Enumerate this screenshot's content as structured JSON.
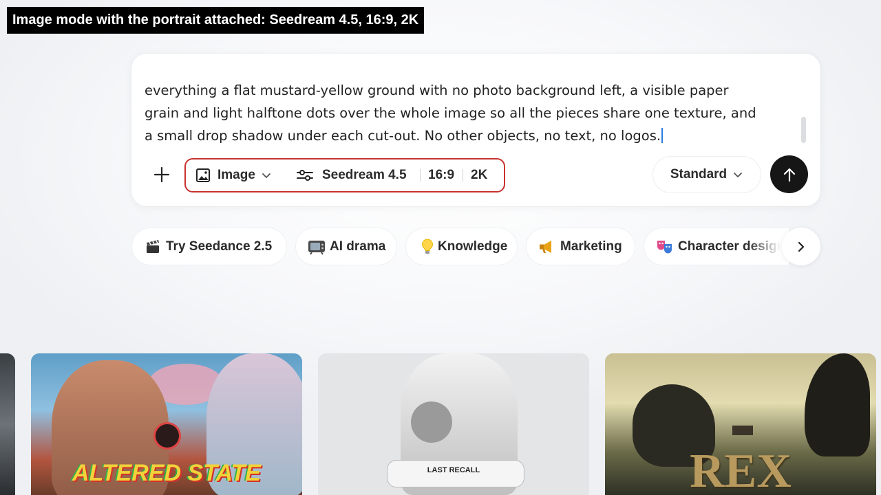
{
  "caption": "Image mode with the portrait attached: Seedream 4.5, 16:9, 2K",
  "composer": {
    "prompt_lines": [
      "everything a flat mustard-yellow ground with no photo background left, a visible paper",
      "grain and light halftone dots over the whole image so all the pieces share one texture, and",
      "a small drop shadow under each cut-out. No other objects, no text, no logos."
    ],
    "mode_label": "Image",
    "model_label": "Seedream 4.5",
    "ratio_label": "16:9",
    "resolution_label": "2K",
    "quality_label": "Standard"
  },
  "chips": [
    {
      "label": "Try Seedance 2.5",
      "icon": "clapperboard-icon"
    },
    {
      "label": "AI drama",
      "icon": "television-icon"
    },
    {
      "label": "Knowledge",
      "icon": "lightbulb-icon"
    },
    {
      "label": "Marketing",
      "icon": "megaphone-icon"
    },
    {
      "label": "Character design",
      "icon": "theater-masks-icon"
    }
  ],
  "gallery": {
    "card1_title": "ALTERED STATE",
    "card2_label": "LAST RECALL",
    "card3_title": "REX"
  },
  "colors": {
    "highlight_border": "#c8322e",
    "send_button": "#161616",
    "caret": "#2a7de1"
  }
}
